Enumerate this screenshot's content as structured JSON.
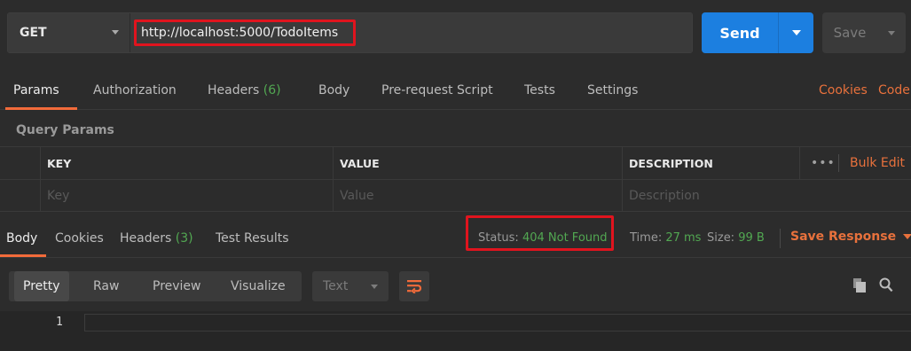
{
  "request": {
    "method": "GET",
    "url": "http://localhost:5000/TodoItems",
    "send_label": "Send",
    "save_label": "Save"
  },
  "request_tabs": [
    {
      "label": "Params",
      "active": true
    },
    {
      "label": "Authorization"
    },
    {
      "label": "Headers",
      "count": "(6)"
    },
    {
      "label": "Body"
    },
    {
      "label": "Pre-request Script"
    },
    {
      "label": "Tests"
    },
    {
      "label": "Settings"
    }
  ],
  "request_links": {
    "cookies": "Cookies",
    "code": "Code"
  },
  "query_params": {
    "title": "Query Params",
    "columns": [
      "KEY",
      "VALUE",
      "DESCRIPTION"
    ],
    "placeholders": [
      "Key",
      "Value",
      "Description"
    ],
    "more_label": "•••",
    "bulk_edit_label": "Bulk Edit"
  },
  "response_tabs": [
    {
      "label": "Body",
      "active": true
    },
    {
      "label": "Cookies"
    },
    {
      "label": "Headers",
      "count": "(3)"
    },
    {
      "label": "Test Results"
    }
  ],
  "response_meta": {
    "status_label": "Status:",
    "status_value": "404 Not Found",
    "time_label": "Time:",
    "time_value": "27 ms",
    "size_label": "Size:",
    "size_value": "99 B",
    "save_response_label": "Save Response"
  },
  "response_view": {
    "modes": [
      "Pretty",
      "Raw",
      "Preview",
      "Visualize"
    ],
    "active_mode": "Pretty",
    "format": "Text"
  },
  "editor": {
    "line_number": "1"
  },
  "colors": {
    "background": "#2c2c2c",
    "accent_blue": "#1c7fe0",
    "accent_orange": "#e8713c",
    "status_green": "#52a852",
    "highlight_red": "#e0141e"
  },
  "icons": [
    "method-dropdown-caret",
    "send-dropdown-caret",
    "save-dropdown-caret",
    "wrap-lines-icon",
    "copy-icon",
    "search-icon"
  ]
}
